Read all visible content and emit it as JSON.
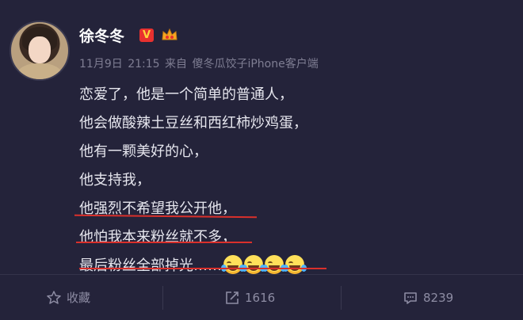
{
  "post": {
    "username": "徐冬冬",
    "vip_badge": "V",
    "date": "11月9日",
    "time": "21:15",
    "from_label": "来自",
    "client": "傻冬瓜饺子iPhone客户端",
    "lines": [
      "恋爱了，他是一个简单的普通人，",
      "他会做酸辣土豆丝和西红柿炒鸡蛋，",
      "他有一颗美好的心，",
      "他支持我，",
      "他强烈不希望我公开他，",
      "他怕我本来粉丝就不多，",
      "最后粉丝全部掉光……"
    ]
  },
  "actions": {
    "favorite_label": "收藏",
    "repost_count": "1616",
    "comment_count": "8239"
  },
  "colors": {
    "background": "#24233a",
    "underline": "#d9302b",
    "muted_text": "#7f7e93"
  }
}
